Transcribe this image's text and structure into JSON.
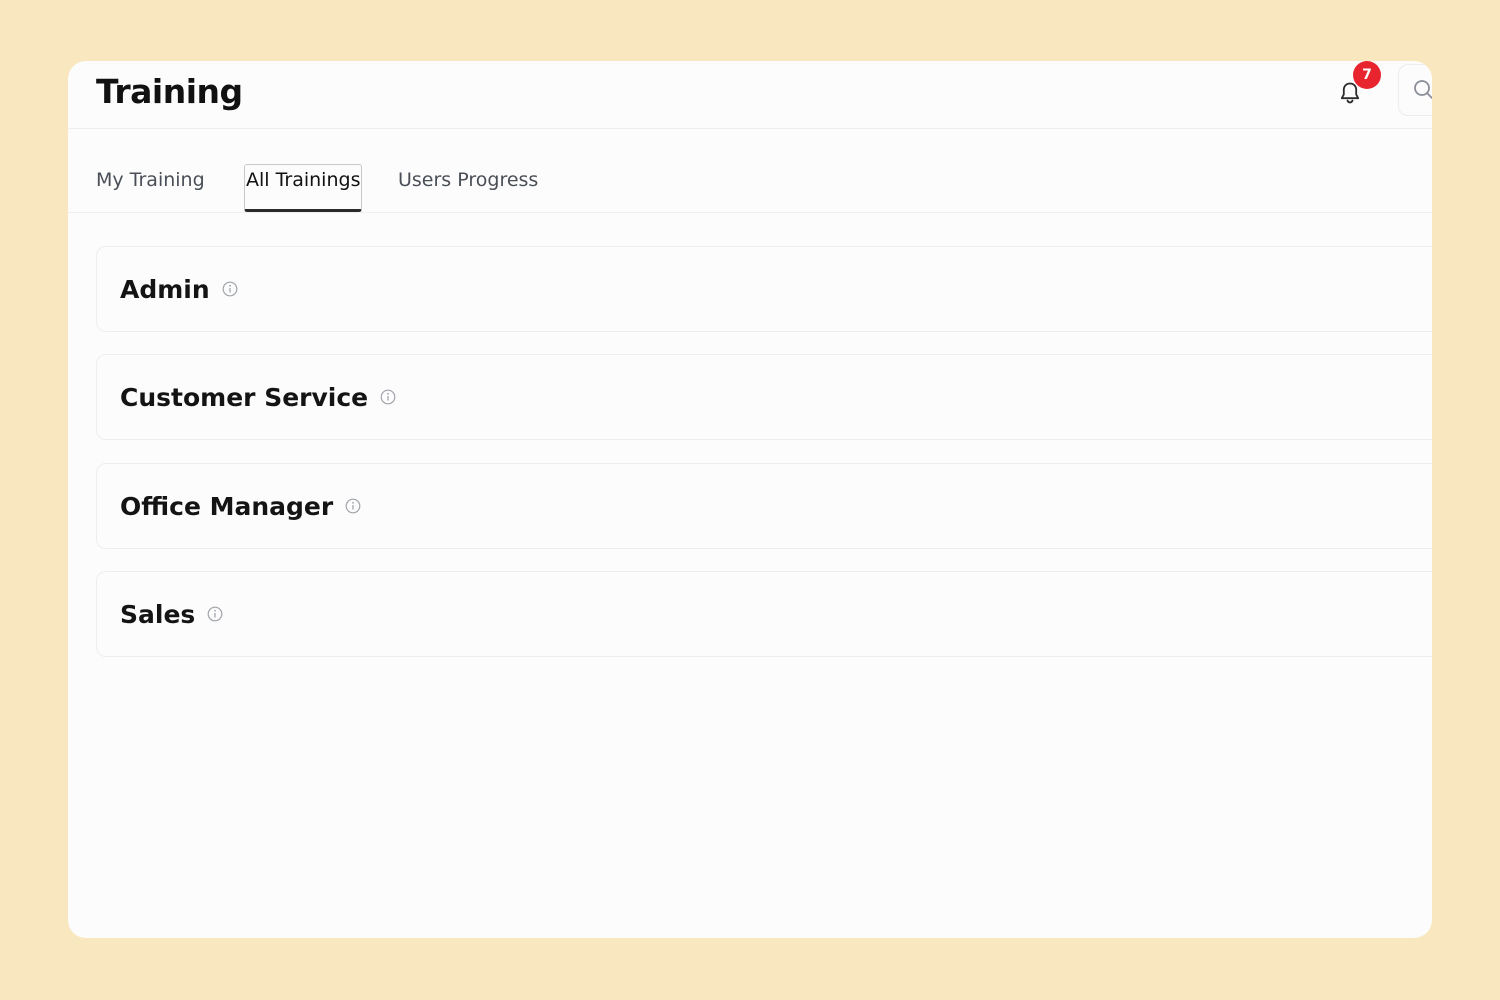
{
  "header": {
    "title": "Training",
    "notification_count": "7",
    "icons": {
      "bell": "bell-icon",
      "search": "search-icon"
    }
  },
  "tabs": [
    {
      "label": "My Training",
      "active": false
    },
    {
      "label": "All Trainings",
      "active": true
    },
    {
      "label": "Users Progress",
      "active": false
    }
  ],
  "groups": [
    {
      "label": "Admin",
      "icon": "info-icon"
    },
    {
      "label": "Customer Service",
      "icon": "info-icon"
    },
    {
      "label": "Office Manager",
      "icon": "info-icon"
    },
    {
      "label": "Sales",
      "icon": "info-icon"
    }
  ],
  "colors": {
    "background": "#f9e8bf",
    "surface": "#fcfcfc",
    "badge": "#e8242f",
    "text": "#111111",
    "muted_text": "#4a4f57"
  }
}
